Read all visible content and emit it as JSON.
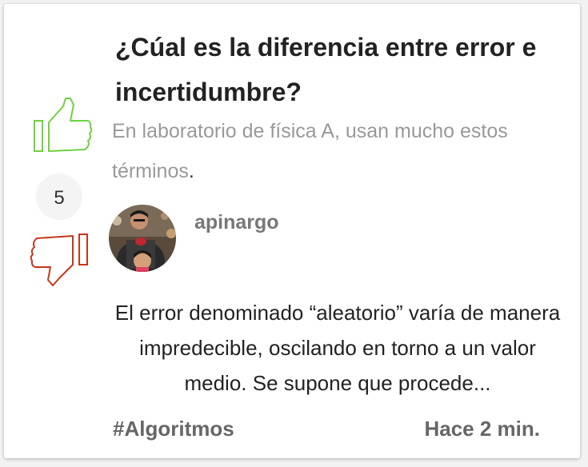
{
  "question": {
    "title": "¿Cúal es la diferencia entre error e incertidumbre?",
    "description": "En laboratorio de física A, usan mucho estos términos",
    "description_end": "."
  },
  "votes": {
    "count": "5",
    "up_icon": "thumbs-up-icon",
    "down_icon": "thumbs-down-icon",
    "up_color": "#6fd23f",
    "down_color": "#c8361c"
  },
  "answer": {
    "author": "apinargo",
    "text": "El error denominado “aleatorio” varía de manera impredecible, oscilando en torno a un valor medio. Se supone que procede..."
  },
  "footer": {
    "tag": "#Algoritmos",
    "time": "Hace 2 min."
  }
}
